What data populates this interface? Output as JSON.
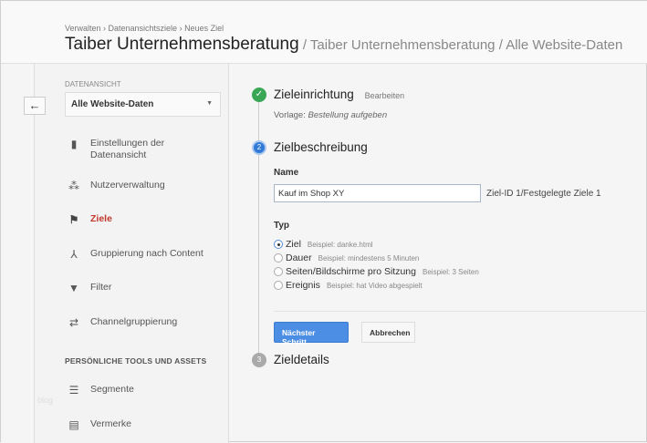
{
  "header": {
    "breadcrumb": "Verwalten › Datenansichtsziele › Neues Ziel",
    "title": "Taiber Unternehmensberatung",
    "subtitle": " / Taiber Unternehmensberatung / Alle Website-Daten"
  },
  "sidebar": {
    "back_icon": "←",
    "view_label": "DATENANSICHT",
    "view_select": "Alle Website-Daten",
    "items": [
      {
        "label": "Einstellungen der Datenansicht",
        "icon": "document-icon"
      },
      {
        "label": "Nutzerverwaltung",
        "icon": "users-icon"
      },
      {
        "label": "Ziele",
        "icon": "flag-icon",
        "active": true
      },
      {
        "label": "Gruppierung nach Content",
        "icon": "content-grouping-icon"
      },
      {
        "label": "Filter",
        "icon": "filter-icon"
      },
      {
        "label": "Channelgruppierung",
        "icon": "channel-icon"
      }
    ],
    "section": "PERSÖNLICHE TOOLS UND ASSETS",
    "tools": [
      {
        "label": "Segmente",
        "icon": "segments-icon"
      },
      {
        "label": "Vermerke",
        "icon": "comment-icon"
      }
    ],
    "watermark": "blog"
  },
  "steps": {
    "s1": {
      "title": "Zieleinrichtung",
      "edit": "Bearbeiten",
      "template_label": "Vorlage: ",
      "template": "Bestellung aufgeben"
    },
    "s2": {
      "number": "2",
      "title": "Zielbeschreibung",
      "name_label": "Name",
      "name_value": "Kauf im Shop XY",
      "goal_id": "Ziel-ID 1/Festgelegte Ziele 1",
      "type_label": "Typ",
      "types": [
        {
          "label": "Ziel",
          "example": "Beispiel: danke.html",
          "selected": true
        },
        {
          "label": "Dauer",
          "example": "Beispiel: mindestens 5 Minuten"
        },
        {
          "label": "Seiten/Bildschirme pro Sitzung",
          "example": "Beispiel: 3 Seiten"
        },
        {
          "label": "Ereignis",
          "example": "Beispiel: hat Video abgespielt"
        }
      ],
      "next": "Nächster Schritt",
      "cancel": "Abbrechen"
    },
    "s3": {
      "number": "3",
      "title": "Zieldetails"
    }
  },
  "colors": {
    "accent": "#4c8ee3",
    "active": "#c0392b",
    "done": "#3aa757"
  }
}
